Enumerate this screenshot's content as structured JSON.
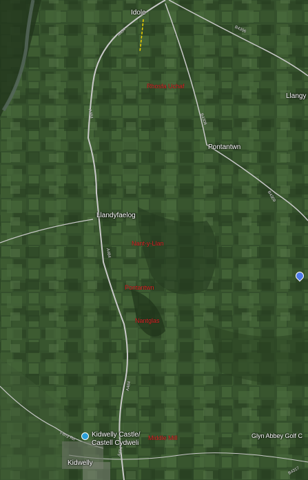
{
  "map": {
    "towns": {
      "idole": "Idole",
      "llangyndeyrn": "Llangy",
      "pontantwn": "Pontantwn",
      "llandyfaelog": "Llandyfaelog",
      "kidwelly": "Kidwelly",
      "glyn_abbey": "Glyn Abbey Golf C"
    },
    "poi": {
      "kidwelly_castle_line1": "Kidwelly Castle/",
      "kidwelly_castle_line2": "Castell Cydweli"
    },
    "markers": {
      "rhosfa_uchaf": "Rhosfa Uchaf",
      "nant_y_llan": "Nant-y-Llan",
      "pontantwn_bridge": "Pontantwn",
      "nantglas": "Nantglas",
      "middle_mill": "Middle Mill"
    },
    "roads": {
      "a484_north": "A484",
      "a484_upper": "A484",
      "a484_middle": "A484",
      "a484_lower": "A484",
      "b4306_north": "B4306",
      "b4306_mid": "B4306",
      "b4309": "B4309",
      "ferry_rd": "Ferry Rd",
      "a484_south": "A484",
      "b4317": "B4317"
    },
    "colors": {
      "land": "#2f4a2a",
      "road": "#c9c9c9",
      "marker": "#e02a2a",
      "poi": "#2b9fd8",
      "path": "#f2d200"
    },
    "icons": {
      "castle": "castle-poi-icon",
      "location": "location-pin-icon"
    }
  }
}
